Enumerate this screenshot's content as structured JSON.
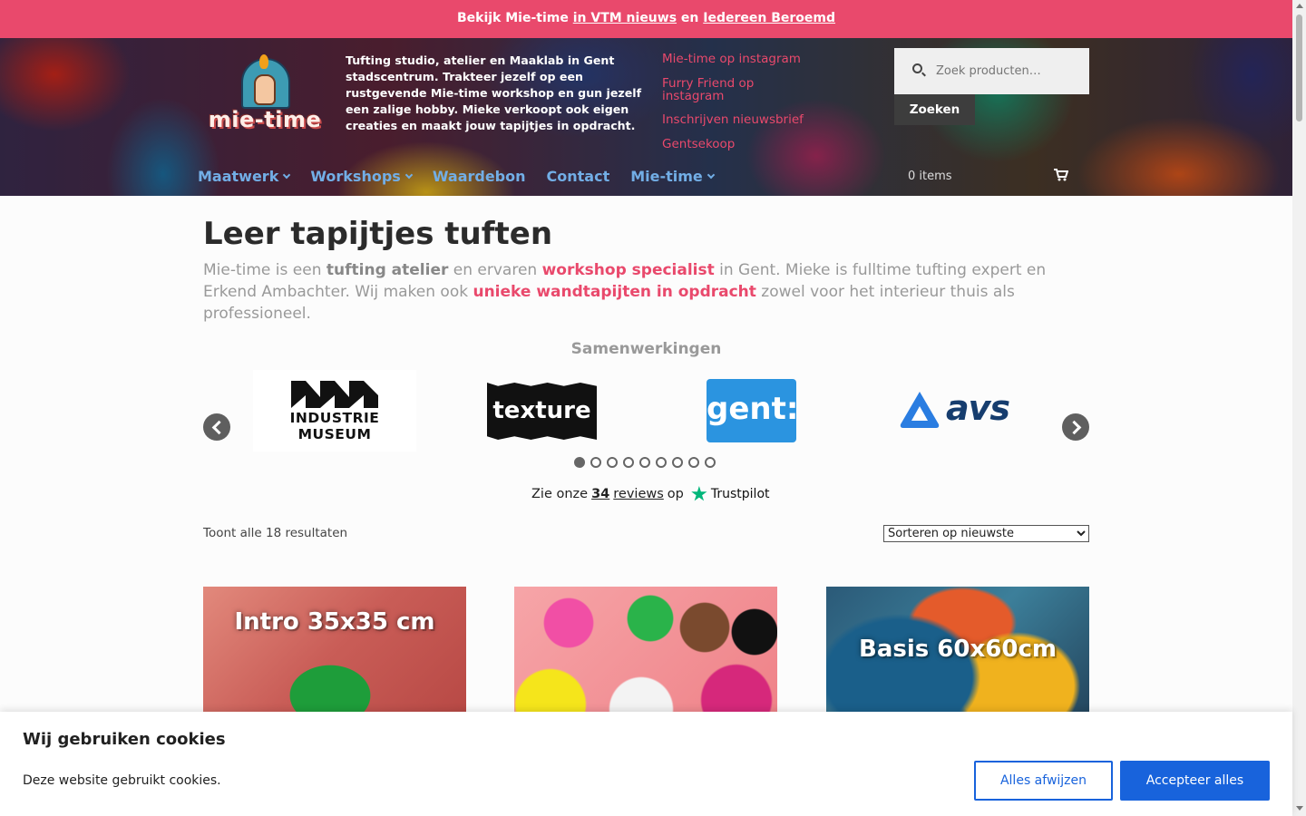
{
  "topbar": {
    "prefix": "Bekijk Mie-time",
    "link1": "in VTM nieuws",
    "middle": "en",
    "link2": "Iedereen Beroemd"
  },
  "header": {
    "logo_text": "mie-time",
    "tagline": "Tufting studio, atelier en Maaklab in Gent stadscentrum. Trakteer jezelf op een rustgevende Mie-time workshop en gun jezelf een zalige hobby. Mieke verkoopt ook eigen creaties en maakt jouw tapijtjes in opdracht.",
    "links": [
      "Mie-time op instagram",
      "Furry Friend op instagram",
      "Inschrijven nieuwsbrief",
      "Gentsekoop"
    ],
    "search": {
      "placeholder": "Zoek producten…",
      "button_label": "Zoeken"
    },
    "nav": [
      {
        "label": "Maatwerk",
        "dropdown": true
      },
      {
        "label": "Workshops",
        "dropdown": true
      },
      {
        "label": "Waardebon",
        "dropdown": false
      },
      {
        "label": "Contact",
        "dropdown": false
      },
      {
        "label": "Mie-time",
        "dropdown": true
      }
    ],
    "cart_count": "0 items",
    "link_color": "#e9496c",
    "nav_color": "#72aee6"
  },
  "main": {
    "title": "Leer tapijtjes tuften",
    "intro": {
      "p1": "Mie-time is een ",
      "b1": "tufting atelier",
      "p2": " en ervaren ",
      "b2": "workshop specialist",
      "p3": " in Gent. Mieke is fulltime tufting expert en Erkend Ambachter. Wij maken ook ",
      "b3": "unieke wandtapijten in opdracht",
      "p4": " zowel voor het interieur thuis als professioneel."
    },
    "partners": {
      "title": "Samenwerkingen",
      "logos": [
        {
          "name": "Industriemuseum",
          "line1": "INDUSTRIE",
          "line2": "MUSEUM"
        },
        {
          "name": "texture",
          "text": "texture"
        },
        {
          "name": "gent",
          "text": "gent:"
        },
        {
          "name": "avs",
          "text": "avs"
        }
      ],
      "dot_count": 9,
      "active_dot": 0
    },
    "trustpilot": {
      "prefix": "Zie onze",
      "count": "34",
      "reviews": "reviews",
      "middle": "op",
      "brand": "Trustpilot"
    },
    "result_count": "Toont alle 18 resultaten",
    "sort": {
      "selected": "Sorteren op nieuwste"
    },
    "products": [
      {
        "label": "Intro 35x35 cm"
      },
      {
        "label": ""
      },
      {
        "label": "Basis 60x60cm"
      }
    ]
  },
  "cookie": {
    "title": "Wij gebruiken cookies",
    "text": "Deze website gebruikt cookies.",
    "reject_label": "Alles afwijzen",
    "accept_label": "Accepteer alles",
    "accent": "#1863dc"
  },
  "colors": {
    "topbar": "#e9496c",
    "accent_pink": "#e9496c"
  }
}
